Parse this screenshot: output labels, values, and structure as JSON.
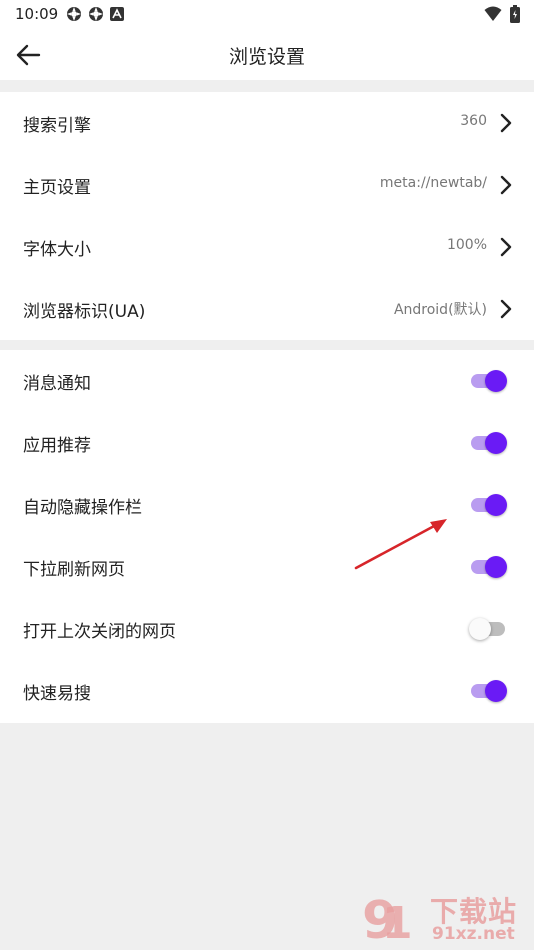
{
  "status_bar": {
    "time": "10:09",
    "left_icons": [
      "gear-icon",
      "gear-icon",
      "a-icon"
    ],
    "right_icons": [
      "wifi-icon",
      "battery-icon"
    ]
  },
  "header": {
    "title": "浏览设置",
    "back_icon": "back-arrow-icon"
  },
  "section1": {
    "rows": [
      {
        "label": "搜索引擎",
        "value": "360"
      },
      {
        "label": "主页设置",
        "value": "meta://newtab/"
      },
      {
        "label": "字体大小",
        "value": "100%"
      },
      {
        "label": "浏览器标识(UA)",
        "value": "Android(默认)"
      }
    ]
  },
  "section2": {
    "toggles": [
      {
        "label": "消息通知",
        "on": true
      },
      {
        "label": "应用推荐",
        "on": true
      },
      {
        "label": "自动隐藏操作栏",
        "on": true
      },
      {
        "label": "下拉刷新网页",
        "on": true
      },
      {
        "label": "打开上次关闭的网页",
        "on": false
      },
      {
        "label": "快速易搜",
        "on": true
      }
    ]
  },
  "colors": {
    "accent": "#6a1bf5",
    "accent_track": "#b99cf0",
    "annotation_arrow": "#d7252a",
    "background": "#efefef"
  },
  "watermark": {
    "brand_text": "下载站",
    "domain_text": "91xz.net"
  }
}
